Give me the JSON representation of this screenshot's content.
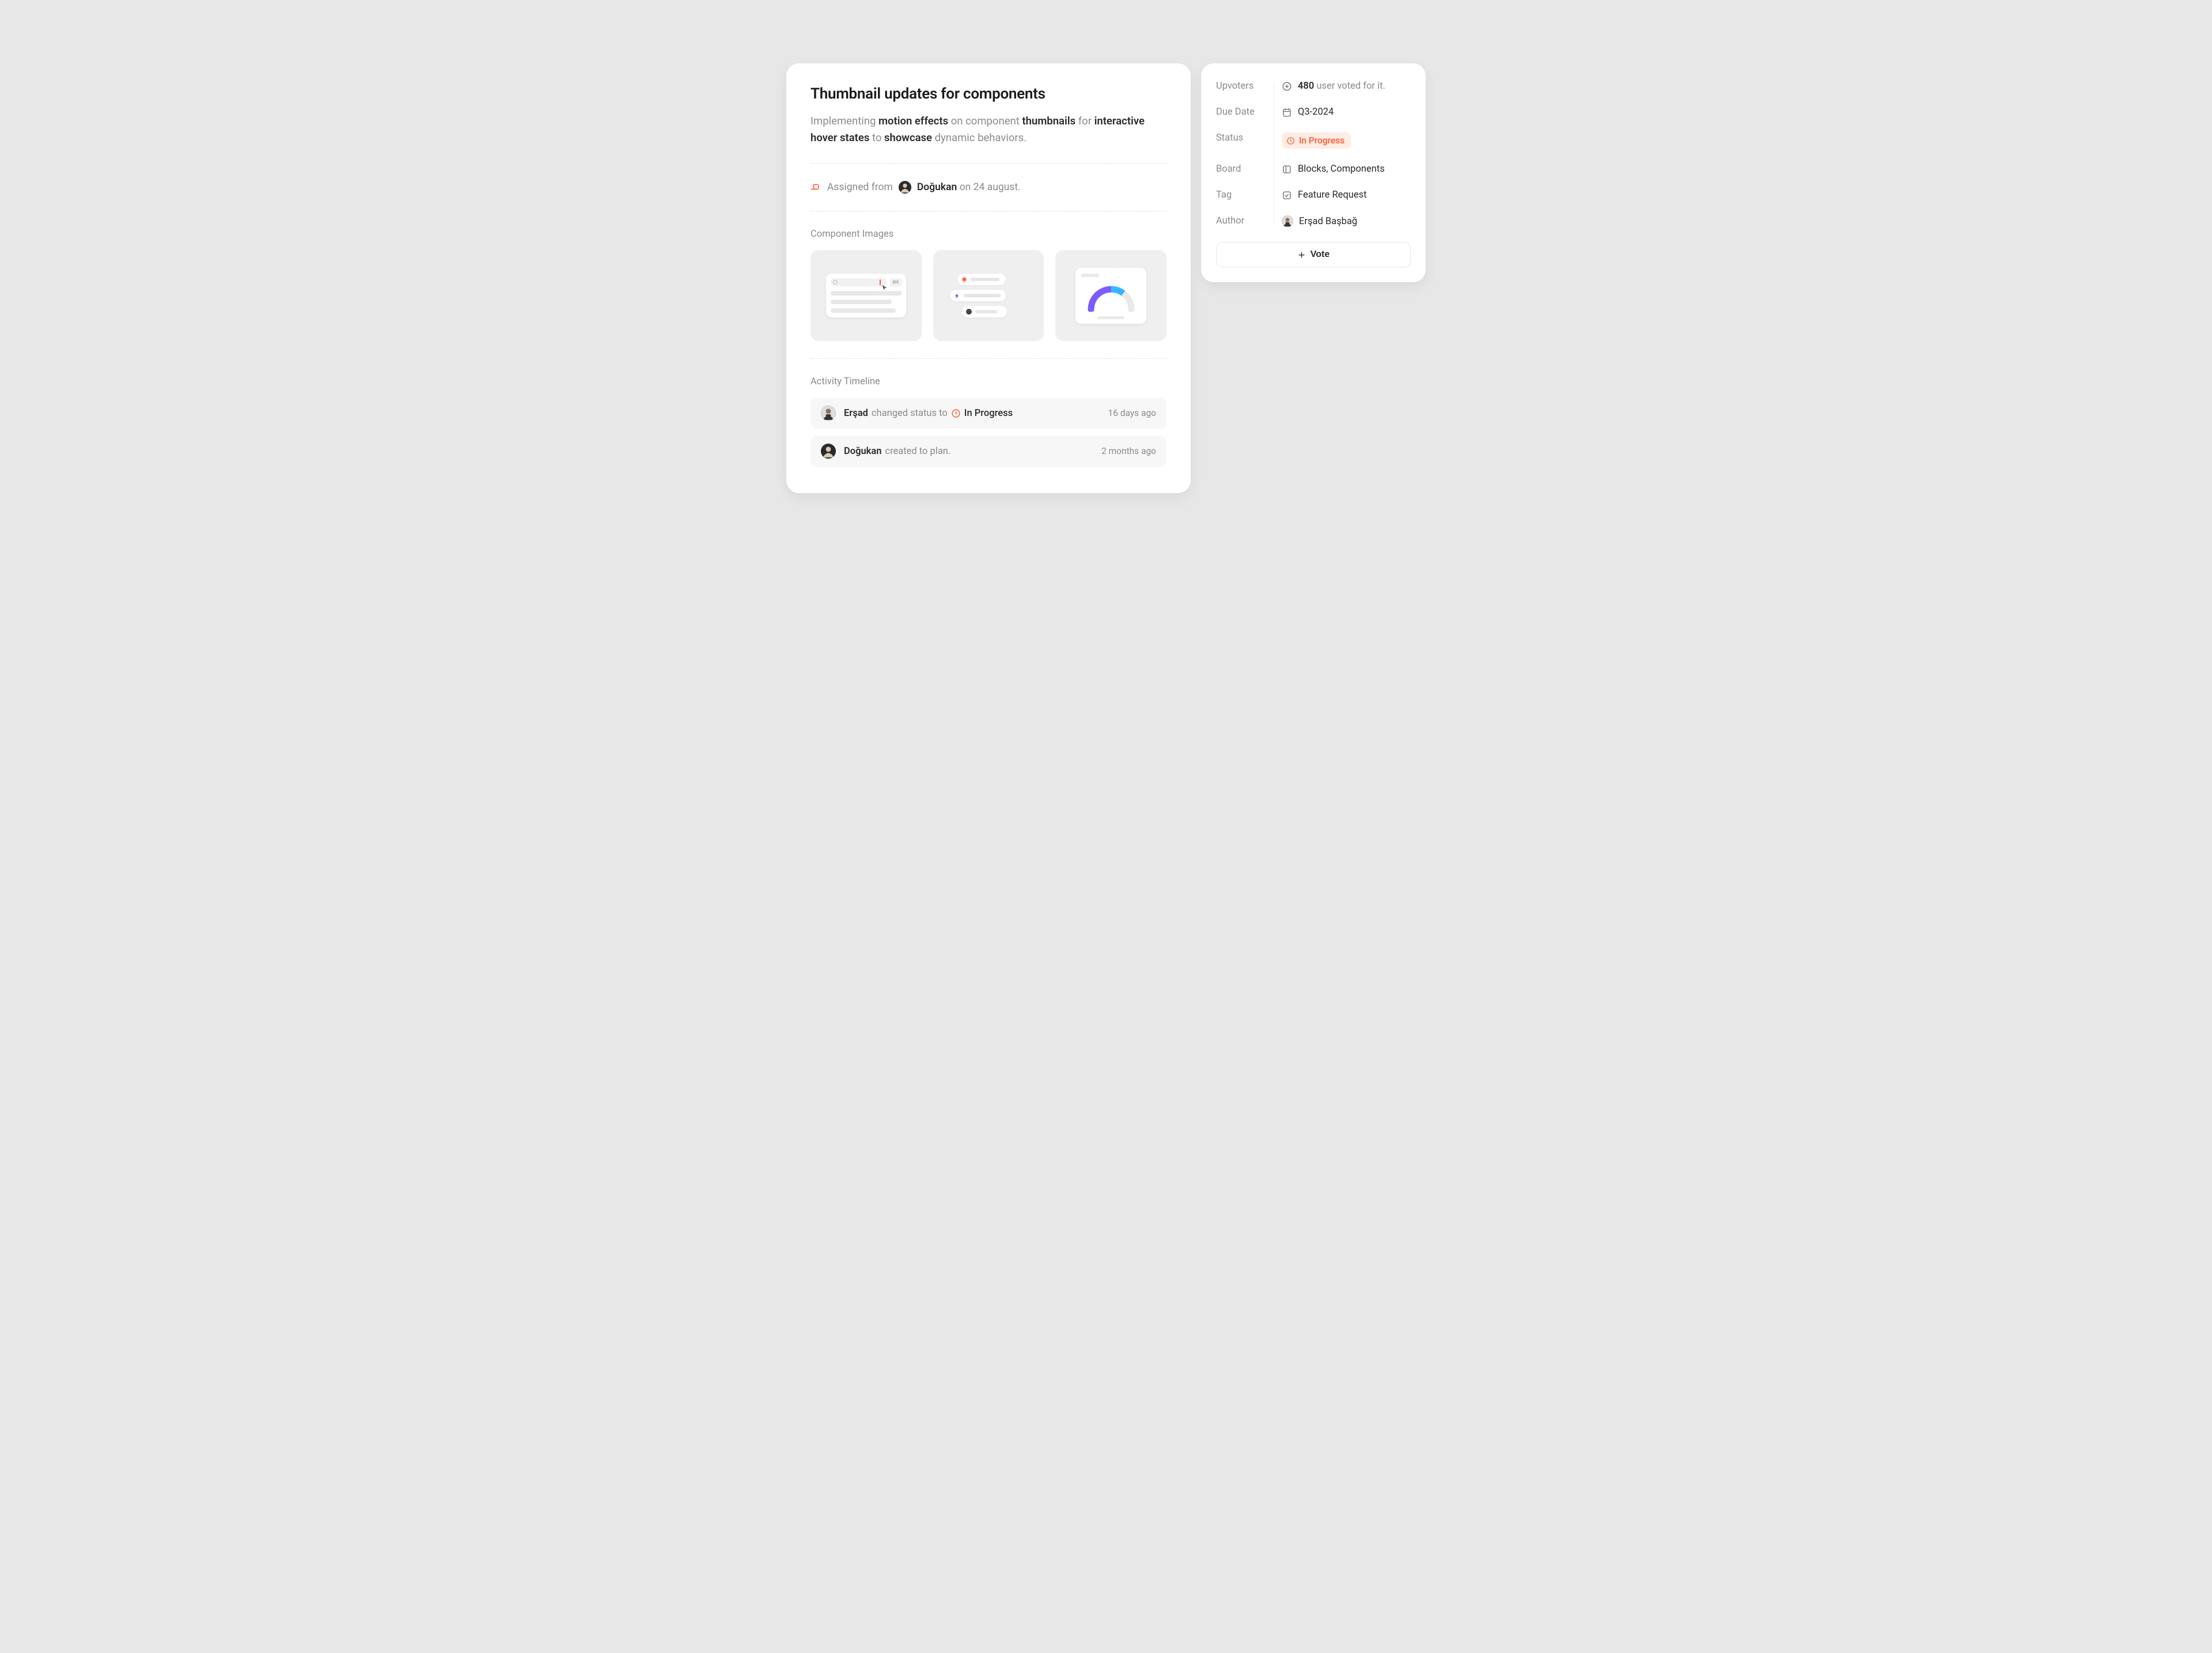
{
  "title": "Thumbnail updates for components",
  "description": {
    "prefix": "Implementing ",
    "b1": "motion effects ",
    "mid1": "on component ",
    "b2": "thumbnails ",
    "mid2": "for ",
    "b3": "interactive hover states ",
    "mid3": "to ",
    "b4": "showcase ",
    "suffix": "dynamic behaviors."
  },
  "assigned": {
    "prefix": "Assigned from",
    "user": "Doğukan",
    "suffix": "on 24 august."
  },
  "images_label": "Component Images",
  "activity_label": "Activity Timeline",
  "activity": [
    {
      "user": "Erşad",
      "action": "changed status to",
      "status": "In Progress",
      "time": "16 days ago"
    },
    {
      "user": "Doğukan",
      "action": "created to plan.",
      "time": "2 months ago"
    }
  ],
  "sidebar": {
    "upvoters_label": "Upvoters",
    "upvoters_count": "480",
    "upvoters_suffix": "user voted for it.",
    "due_label": "Due Date",
    "due_value": "Q3-2024",
    "status_label": "Status",
    "status_value": "In Progress",
    "board_label": "Board",
    "board_value": "Blocks, Components",
    "tag_label": "Tag",
    "tag_value": "Feature Request",
    "author_label": "Author",
    "author_value": "Erşad Başbağ",
    "vote_label": "Vote"
  }
}
